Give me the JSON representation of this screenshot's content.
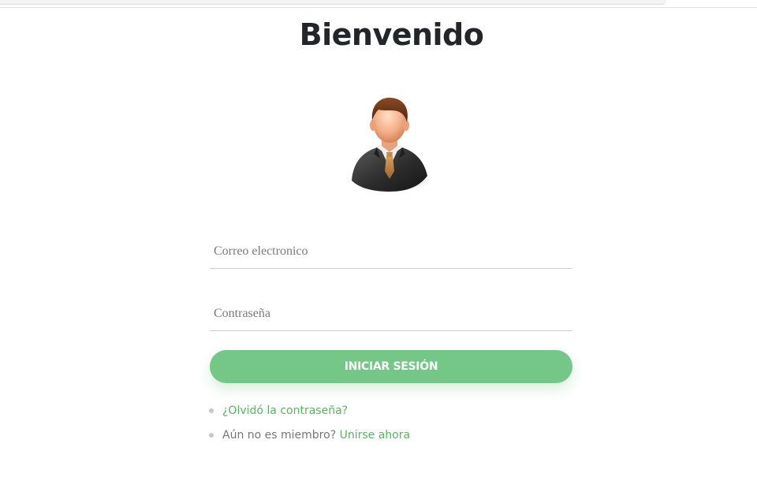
{
  "page": {
    "title": "Bienvenido"
  },
  "avatar": {
    "icon": "user-businessman-icon"
  },
  "form": {
    "email_placeholder": "Correo electronico",
    "password_placeholder": "Contraseña",
    "submit_label": "INICIAR SESIÓN"
  },
  "links": {
    "forgot_password": "¿Olvidó la contraseña?",
    "not_member_text": "Aún no es miembro?",
    "join_now": "Unirse ahora"
  },
  "colors": {
    "accent": "#74c787",
    "link": "#56b55f",
    "title": "#23252b"
  }
}
